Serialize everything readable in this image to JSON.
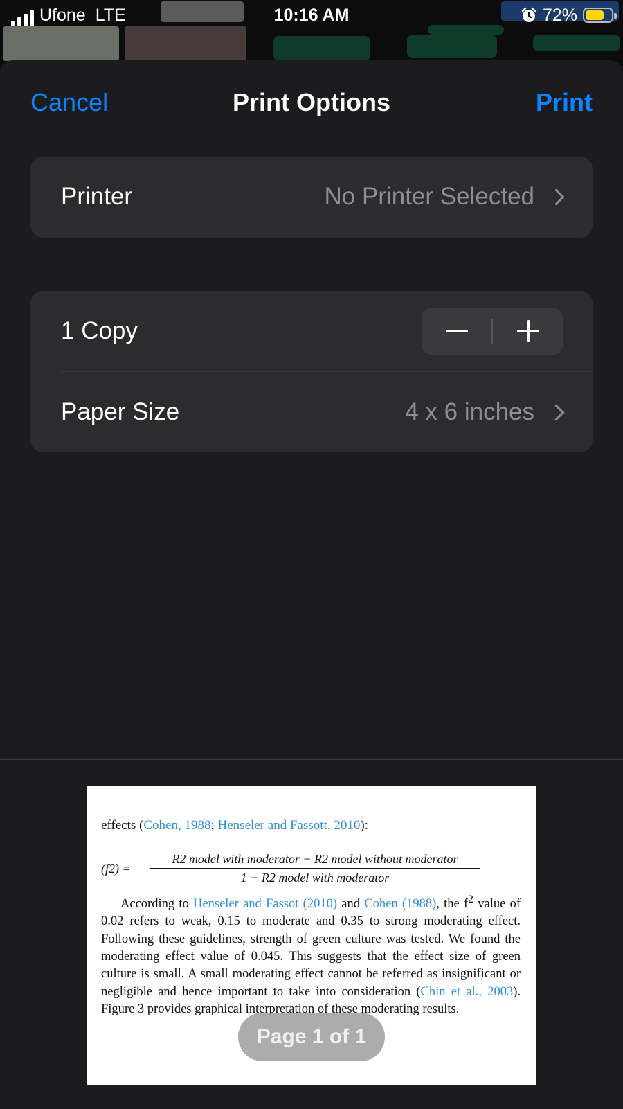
{
  "status_bar": {
    "carrier": "Ufone",
    "network": "LTE",
    "time": "10:16 AM",
    "battery_percent": "72%",
    "battery_level": 0.72,
    "icons": [
      "signal-bars-icon",
      "alarm-icon",
      "battery-icon"
    ],
    "battery_color": "#ffd60a"
  },
  "nav": {
    "cancel_label": "Cancel",
    "title": "Print Options",
    "print_label": "Print",
    "accent_color": "#0a84ff"
  },
  "printer": {
    "label": "Printer",
    "value": "No Printer Selected"
  },
  "copies": {
    "label": "1 Copy",
    "minus_symbol": "−",
    "plus_symbol": "+"
  },
  "paper_size": {
    "label": "Paper Size",
    "value": "4 x 6 inches"
  },
  "preview": {
    "cut_line_prefix": "effects (",
    "cut_link_1": "Cohen, 1988",
    "cut_sep": "; ",
    "cut_link_2": "Henseler and Fassott, 2010",
    "cut_suffix": "):",
    "formula_lhs": "(f2) =",
    "formula_numerator": "R2 model with moderator − R2 model without moderator",
    "formula_denominator": "1 − R2 model with moderator",
    "para_start": "According to ",
    "para_link_1": "Henseler and Fassot (2010)",
    "para_and": " and ",
    "para_link_2": "Cohen (1988)",
    "para_mid": ", the f",
    "para_sup": "2",
    "para_body": " value of 0.02 refers to weak, 0.15 to moderate and 0.35 to strong moderating effect. Following these guidelines, strength of green culture was tested. We found the moderating effect value of 0.045. This suggests that the effect size of green culture is small. A small moderating effect cannot be referred as insignificant or negligible and hence important to take into consideration (",
    "para_link_3": "Chin et al., 2003",
    "para_end": "). Figure 3 provides graphical interpretation of these moderating results.",
    "page_indicator": "Page 1 of 1"
  }
}
